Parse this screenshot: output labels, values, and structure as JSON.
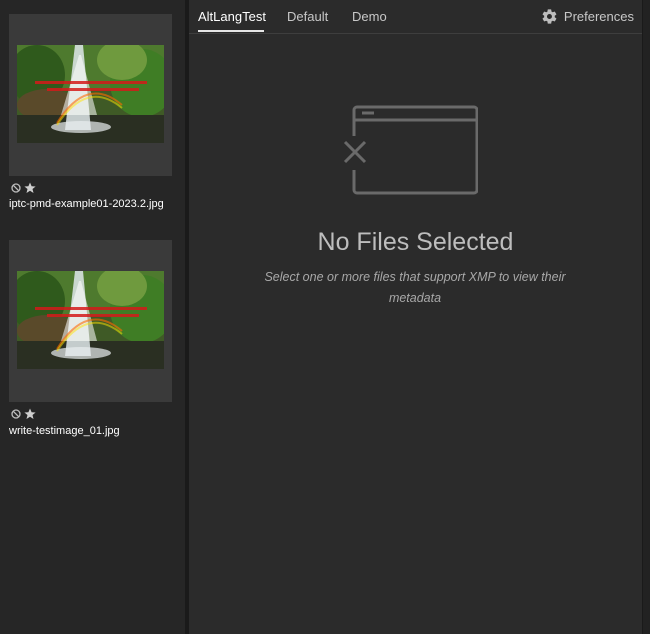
{
  "tabs": [
    {
      "label": "AltLangTest",
      "active": true
    },
    {
      "label": "Default",
      "active": false
    },
    {
      "label": "Demo",
      "active": false
    }
  ],
  "preferences": {
    "label": "Preferences",
    "icon": "gear-icon"
  },
  "empty_state": {
    "icon": "file-error-icon",
    "title": "No Files Selected",
    "subtitle": "Select one or more files that support XMP to view their metadata"
  },
  "files": [
    {
      "name": "iptc-pmd-example01-2023.2.jpg",
      "icons": [
        "no-label-icon",
        "star-icon"
      ]
    },
    {
      "name": "write-testimage_01.jpg",
      "icons": [
        "no-label-icon",
        "star-icon"
      ]
    }
  ],
  "colors": {
    "panel_bg": "#2b2b2b",
    "filmstrip_bg": "#262626",
    "card_bg": "#3a3a3a",
    "accent": "#e6e6e6"
  }
}
